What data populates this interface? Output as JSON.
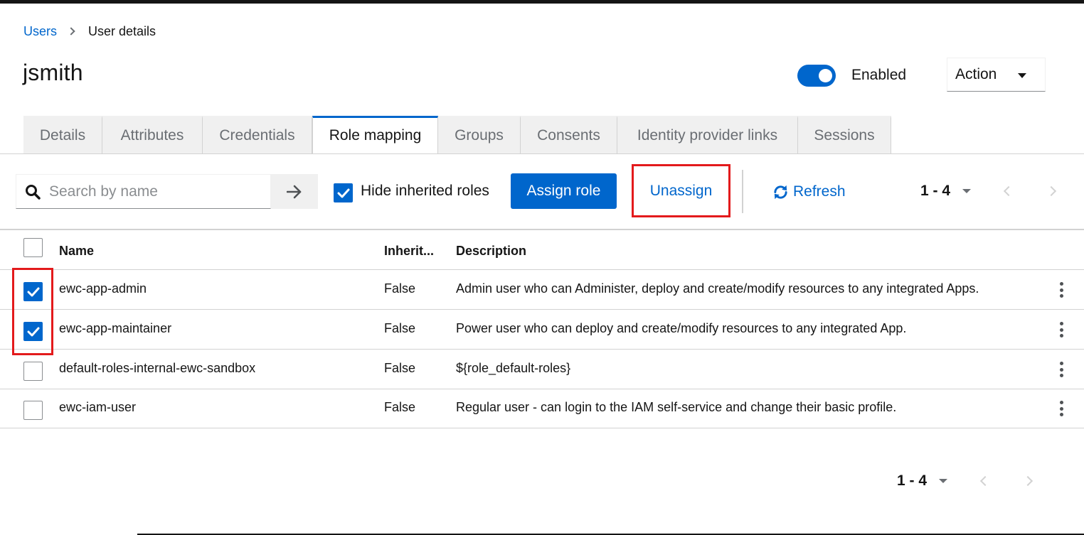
{
  "breadcrumb": {
    "parent": "Users",
    "current": "User details"
  },
  "header": {
    "title": "jsmith",
    "enabled_label": "Enabled",
    "enabled": true,
    "action_label": "Action"
  },
  "tabs": [
    {
      "label": "Details"
    },
    {
      "label": "Attributes"
    },
    {
      "label": "Credentials"
    },
    {
      "label": "Role mapping",
      "active": true
    },
    {
      "label": "Groups"
    },
    {
      "label": "Consents"
    },
    {
      "label": "Identity provider links"
    },
    {
      "label": "Sessions"
    }
  ],
  "toolbar": {
    "search_placeholder": "Search by name",
    "hide_inherited_label": "Hide inherited roles",
    "hide_inherited_checked": true,
    "assign_label": "Assign role",
    "unassign_label": "Unassign",
    "refresh_label": "Refresh",
    "pagination": "1 - 4"
  },
  "table": {
    "columns": {
      "name": "Name",
      "inherited": "Inherit...",
      "description": "Description"
    },
    "rows": [
      {
        "name": "ewc-app-admin",
        "inherited": "False",
        "description": "Admin user who can Administer, deploy and create/modify resources to any integrated Apps.",
        "checked": true
      },
      {
        "name": "ewc-app-maintainer",
        "inherited": "False",
        "description": "Power user who can deploy and create/modify resources to any integrated App.",
        "checked": true
      },
      {
        "name": "default-roles-internal-ewc-sandbox",
        "inherited": "False",
        "description": "${role_default-roles}",
        "checked": false
      },
      {
        "name": "ewc-iam-user",
        "inherited": "False",
        "description": "Regular user - can login to the IAM self-service and change their basic profile.",
        "checked": false
      }
    ]
  },
  "footer": {
    "pagination": "1 - 4"
  },
  "colors": {
    "accent": "#0066cc",
    "highlight": "#e31a1c"
  }
}
